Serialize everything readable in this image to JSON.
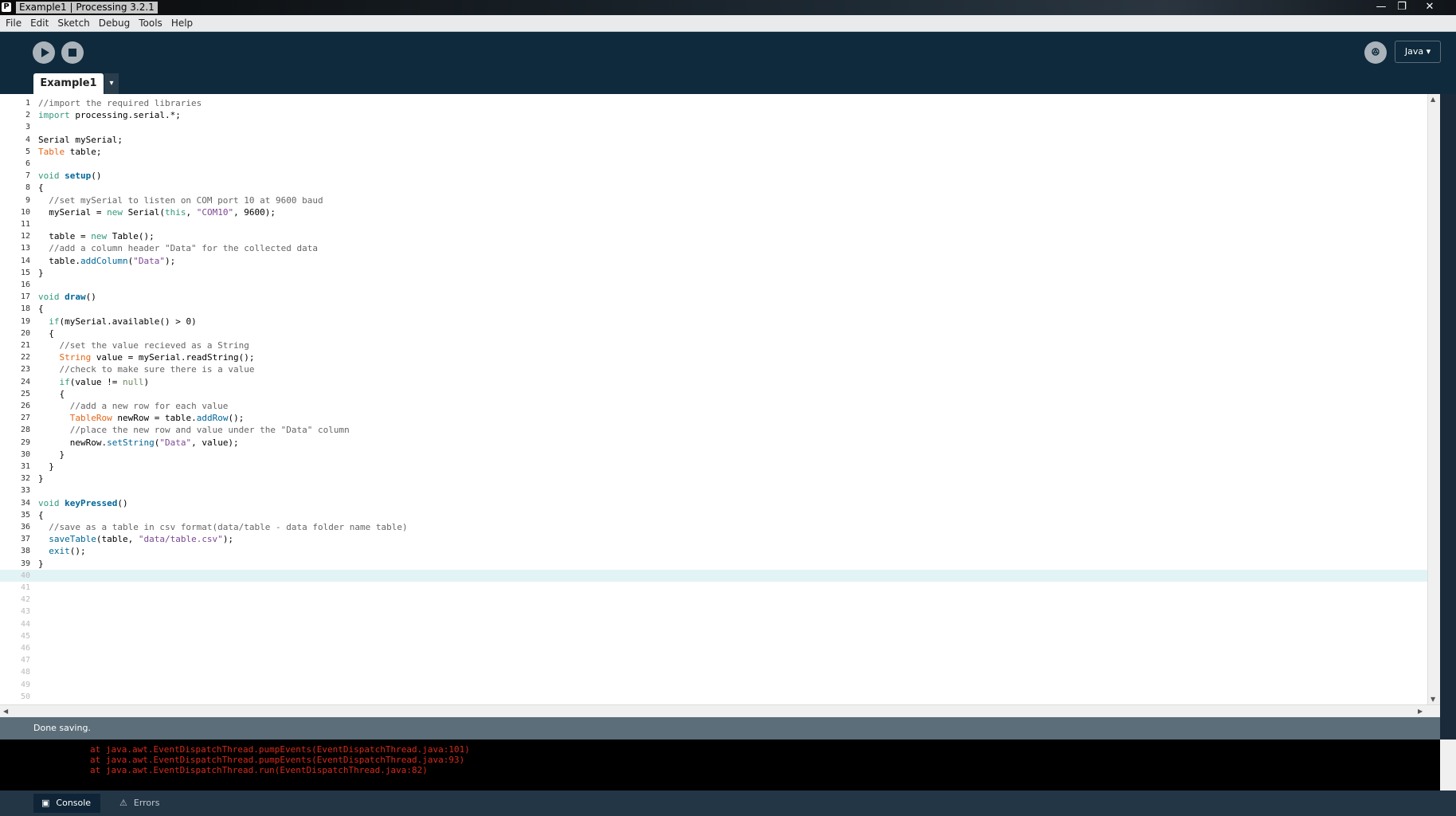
{
  "window": {
    "title": "Example1 | Processing 3.2.1",
    "icon": "processing-icon",
    "controls": [
      "—",
      "❐",
      "✕"
    ]
  },
  "menu": [
    "File",
    "Edit",
    "Sketch",
    "Debug",
    "Tools",
    "Help"
  ],
  "toolbar": {
    "run": "play-icon",
    "stop": "stop-icon",
    "debug": "debug-icon",
    "mode_label": "Java ▾"
  },
  "tab": {
    "label": "Example1",
    "menu_arrow": "▾"
  },
  "editor": {
    "code": [
      [
        [
          "cmt",
          "//import the required libraries"
        ]
      ],
      [
        [
          "kw",
          "import"
        ],
        [
          "",
          " processing.serial.*;"
        ]
      ],
      [],
      [
        [
          "",
          "Serial mySerial;"
        ]
      ],
      [
        [
          "ty",
          "Table"
        ],
        [
          "",
          " table;"
        ]
      ],
      [],
      [
        [
          "kw",
          "void"
        ],
        [
          "",
          " "
        ],
        [
          "fn",
          "setup"
        ],
        [
          "",
          "()"
        ]
      ],
      [
        [
          "",
          "{"
        ]
      ],
      [
        [
          "",
          "  "
        ],
        [
          "cmt",
          "//set mySerial to listen on COM port 10 at 9600 baud"
        ]
      ],
      [
        [
          "",
          "  mySerial = "
        ],
        [
          "kw",
          "new"
        ],
        [
          "",
          " Serial("
        ],
        [
          "kw",
          "this"
        ],
        [
          "",
          ", "
        ],
        [
          "st",
          "\"COM10\""
        ],
        [
          "",
          ", 9600);"
        ]
      ],
      [],
      [
        [
          "",
          "  table = "
        ],
        [
          "kw",
          "new"
        ],
        [
          "",
          " Table();"
        ]
      ],
      [
        [
          "",
          "  "
        ],
        [
          "cmt",
          "//add a column header \"Data\" for the collected data"
        ]
      ],
      [
        [
          "",
          "  table."
        ],
        [
          "mt",
          "addColumn"
        ],
        [
          "",
          "("
        ],
        [
          "st",
          "\"Data\""
        ],
        [
          "",
          ");"
        ]
      ],
      [
        [
          "",
          "}"
        ]
      ],
      [],
      [
        [
          "kw",
          "void"
        ],
        [
          "",
          " "
        ],
        [
          "fn",
          "draw"
        ],
        [
          "",
          "()"
        ]
      ],
      [
        [
          "",
          "{"
        ]
      ],
      [
        [
          "",
          "  "
        ],
        [
          "kw",
          "if"
        ],
        [
          "",
          "(mySerial.available() > 0)"
        ]
      ],
      [
        [
          "",
          "  {"
        ]
      ],
      [
        [
          "",
          "    "
        ],
        [
          "cmt",
          "//set the value recieved as a String"
        ]
      ],
      [
        [
          "",
          "    "
        ],
        [
          "ty",
          "String"
        ],
        [
          "",
          " value = mySerial.readString();"
        ]
      ],
      [
        [
          "",
          "    "
        ],
        [
          "cmt",
          "//check to make sure there is a value"
        ]
      ],
      [
        [
          "",
          "    "
        ],
        [
          "kw",
          "if"
        ],
        [
          "",
          "(value != "
        ],
        [
          "lt",
          "null"
        ],
        [
          "",
          ")"
        ]
      ],
      [
        [
          "",
          "    {"
        ]
      ],
      [
        [
          "",
          "      "
        ],
        [
          "cmt",
          "//add a new row for each value"
        ]
      ],
      [
        [
          "",
          "      "
        ],
        [
          "ty",
          "TableRow"
        ],
        [
          "",
          " newRow = table."
        ],
        [
          "mt",
          "addRow"
        ],
        [
          "",
          "();"
        ]
      ],
      [
        [
          "",
          "      "
        ],
        [
          "cmt",
          "//place the new row and value under the \"Data\" column"
        ]
      ],
      [
        [
          "",
          "      newRow."
        ],
        [
          "mt",
          "setString"
        ],
        [
          "",
          "("
        ],
        [
          "st",
          "\"Data\""
        ],
        [
          "",
          ", value);"
        ]
      ],
      [
        [
          "",
          "    }"
        ]
      ],
      [
        [
          "",
          "  }"
        ]
      ],
      [
        [
          "",
          "}"
        ]
      ],
      [],
      [
        [
          "kw",
          "void"
        ],
        [
          "",
          " "
        ],
        [
          "fn",
          "keyPressed"
        ],
        [
          "",
          "()"
        ]
      ],
      [
        [
          "",
          "{"
        ]
      ],
      [
        [
          "",
          "  "
        ],
        [
          "cmt",
          "//save as a table in csv format(data/table - data folder name table)"
        ]
      ],
      [
        [
          "",
          "  "
        ],
        [
          "mt",
          "saveTable"
        ],
        [
          "",
          "(table, "
        ],
        [
          "st",
          "\"data/table.csv\""
        ],
        [
          "",
          ");"
        ]
      ],
      [
        [
          "",
          "  "
        ],
        [
          "mt",
          "exit"
        ],
        [
          "",
          "();"
        ]
      ],
      [
        [
          "",
          "}"
        ]
      ],
      []
    ],
    "line_numbers": [
      "1",
      "2",
      "3",
      "4",
      "5",
      "6",
      "7",
      "8",
      "9",
      "10",
      "11",
      "12",
      "13",
      "14",
      "15",
      "16",
      "17",
      "18",
      "19",
      "20",
      "21",
      "22",
      "23",
      "24",
      "25",
      "26",
      "27",
      "28",
      "29",
      "30",
      "31",
      "32",
      "33",
      "34",
      "35",
      "36",
      "37",
      "38",
      "39",
      "40",
      "41",
      "42",
      "43",
      "44",
      "45",
      "46",
      "47",
      "48",
      "49",
      "50"
    ],
    "current_line": 40,
    "code_line_count": 39
  },
  "status": {
    "message": "Done saving."
  },
  "console": {
    "lines": [
      "at java.awt.EventDispatchThread.pumpEvents(EventDispatchThread.java:101)",
      "at java.awt.EventDispatchThread.pumpEvents(EventDispatchThread.java:93)",
      "at java.awt.EventDispatchThread.run(EventDispatchThread.java:82)"
    ]
  },
  "footer": {
    "console_label": "Console",
    "errors_label": "Errors"
  },
  "colors": {
    "toolbar": "#0f2a3c",
    "status": "#5c6e7a",
    "error_text": "#d42a1b",
    "current_line": "#e2f3f6"
  }
}
